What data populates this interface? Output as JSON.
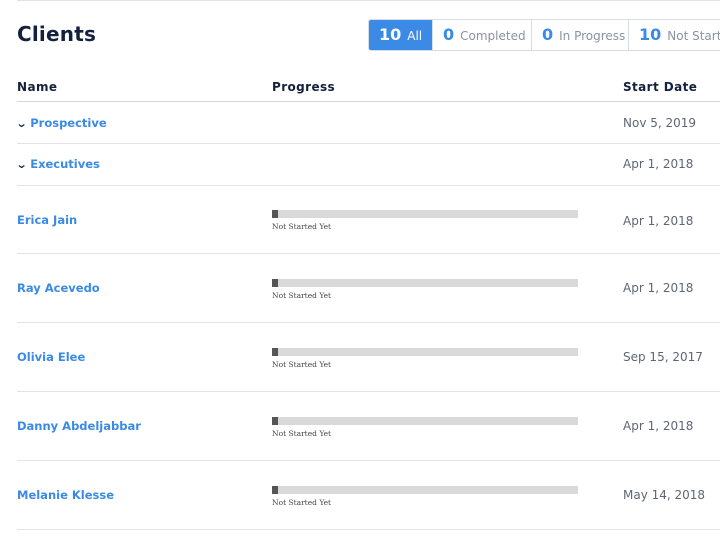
{
  "page": {
    "title": "Clients"
  },
  "filters": [
    {
      "count": "10",
      "label": "All",
      "active": true
    },
    {
      "count": "0",
      "label": "Completed",
      "active": false
    },
    {
      "count": "0",
      "label": "In Progress",
      "active": false
    },
    {
      "count": "10",
      "label": "Not Started",
      "active": false
    }
  ],
  "table": {
    "headers": {
      "name": "Name",
      "progress": "Progress",
      "start_date": "Start Date"
    },
    "groups": [
      {
        "name": "Prospective",
        "start_date": "Nov 5, 2019"
      },
      {
        "name": "Executives",
        "start_date": "Apr 1, 2018"
      }
    ],
    "clients": [
      {
        "name": "Erica Jain",
        "progress": 0.02,
        "status": "Not Started Yet",
        "start_date": "Apr 1, 2018"
      },
      {
        "name": "Ray Acevedo",
        "progress": 0.02,
        "status": "Not Started Yet",
        "start_date": "Apr 1, 2018"
      },
      {
        "name": "Olivia Elee",
        "progress": 0.02,
        "status": "Not Started Yet",
        "start_date": "Sep 15, 2017"
      },
      {
        "name": "Danny Abdeljabbar",
        "progress": 0.02,
        "status": "Not Started Yet",
        "start_date": "Apr 1, 2018"
      },
      {
        "name": "Melanie Klesse",
        "progress": 0.02,
        "status": "Not Started Yet",
        "start_date": "May 14, 2018"
      }
    ]
  },
  "colors": {
    "accent": "#3a8ae6",
    "heading": "#13213f",
    "bar_track": "#d9d9d9",
    "bar_fill": "#555555"
  },
  "icons": {
    "group_toggle": "chevron-down-icon"
  }
}
